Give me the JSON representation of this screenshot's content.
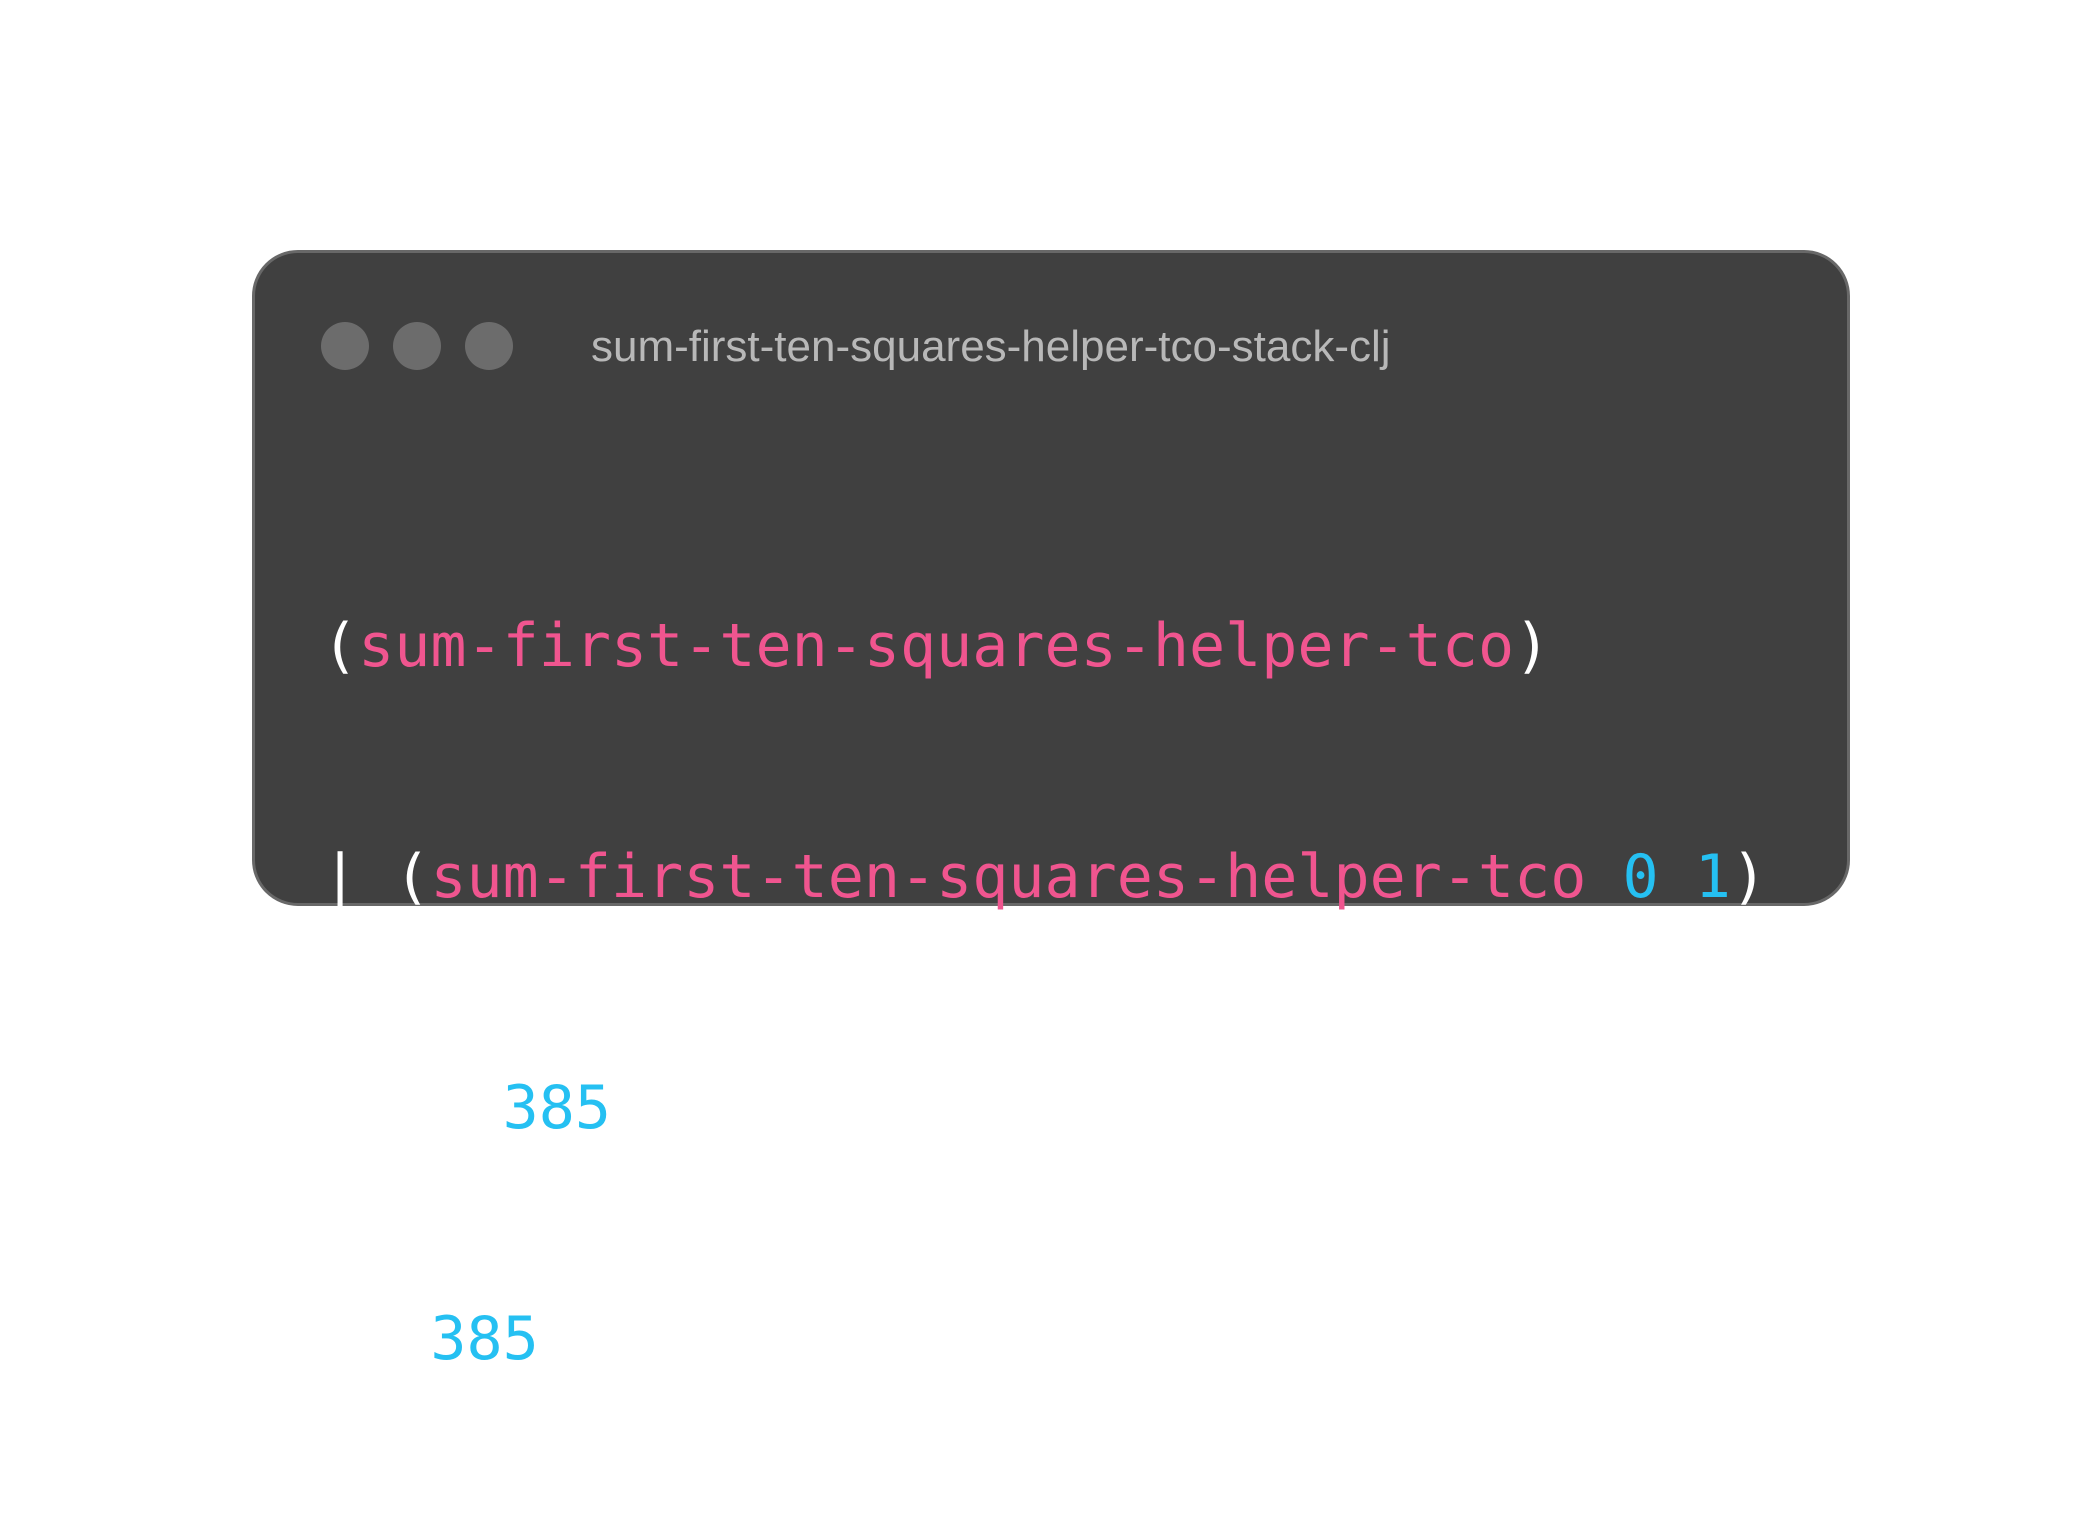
{
  "window": {
    "title": "sum-first-ten-squares-helper-tco-stack-clj"
  },
  "code": {
    "line1": {
      "open": "(",
      "fn": "sum-first-ten-squares-helper-tco",
      "close": ")"
    },
    "line2": {
      "prefix": "| (",
      "fn": "sum-first-ten-squares-helper-tco",
      "arg1": "0",
      "arg2": "1",
      "close": ")"
    },
    "line3": {
      "prefix": "| => ",
      "value": "385"
    },
    "line4": {
      "prefix": "=> ",
      "value": "385"
    }
  },
  "colors": {
    "background": "#404040",
    "function": "#f0558f",
    "number": "#25c0f2",
    "text": "#ffffff",
    "title": "#b8b8b8",
    "traffic_light": "#6c6c6c"
  }
}
